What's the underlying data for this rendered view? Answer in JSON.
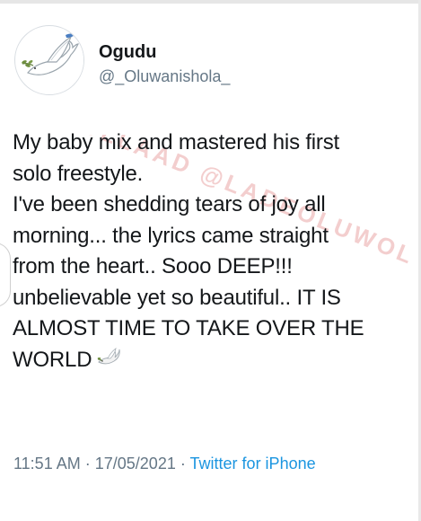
{
  "tweet": {
    "author": {
      "display_name": "Ogudu",
      "handle": "@_Oluwanishola_",
      "avatar_icon": "white-dove-icon"
    },
    "text_lines": [
      "My baby mix and mastered his first",
      "solo freestyle.",
      "I've been shedding tears of joy all",
      "morning... the lyrics came straight",
      "from the heart.. Sooo DEEP!!!",
      "unbelievable yet so beautiful.. IT IS",
      "ALMOST TIME TO TAKE OVER THE",
      "WORLD"
    ],
    "emoji": "dove-emoji",
    "time": "11:51 AM",
    "separator": "·",
    "date": "17/05/2021",
    "source": "Twitter for iPhone"
  },
  "watermark": {
    "text": "OLLAAD @LADEOLUWOLO"
  },
  "colors": {
    "text": "#14171a",
    "secondary": "#657786",
    "link": "#1b95e0",
    "watermark": "#e9a6a6"
  }
}
